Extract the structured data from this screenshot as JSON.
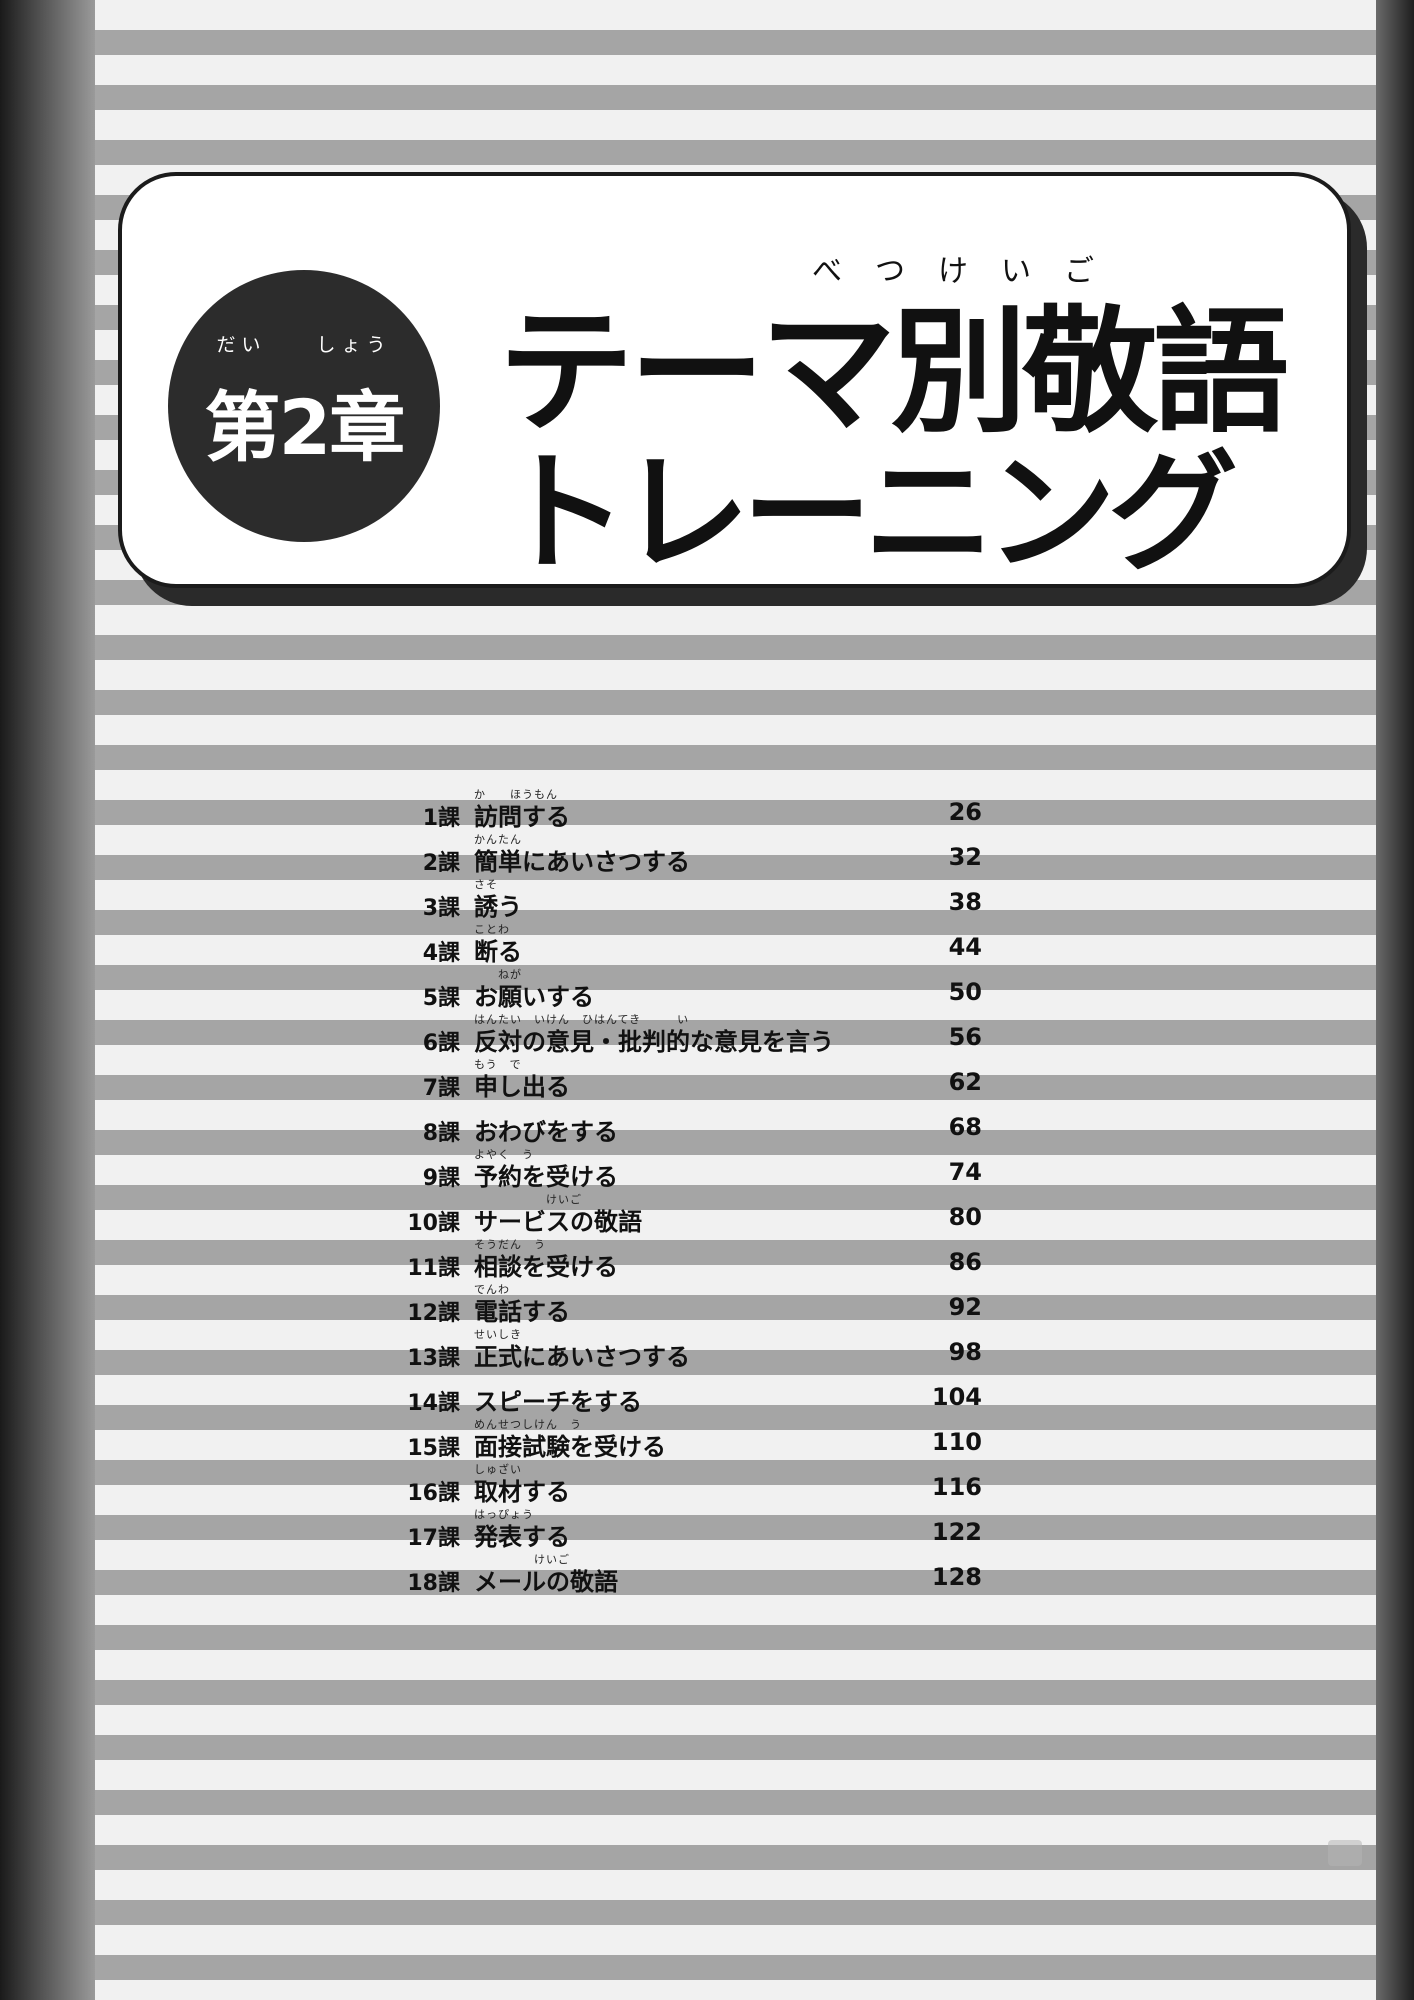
{
  "chapter": {
    "ruby": "だい　　しょう",
    "label": "第2章",
    "title_ruby": "べつけいご",
    "title_line1": "テーマ別敬語",
    "title_line2": "トレーニング"
  },
  "toc": [
    {
      "num": "1課",
      "ruby": "か　　ほうもん",
      "title": "訪問する",
      "page": "26"
    },
    {
      "num": "2課",
      "ruby": "かんたん",
      "title": "簡単にあいさつする",
      "page": "32"
    },
    {
      "num": "3課",
      "ruby": "さそ",
      "title": "誘う",
      "page": "38"
    },
    {
      "num": "4課",
      "ruby": "ことわ",
      "title": "断る",
      "page": "44"
    },
    {
      "num": "5課",
      "ruby": "　　ねが",
      "title": "お願いする",
      "page": "50"
    },
    {
      "num": "6課",
      "ruby": "はんたい　いけん　ひはんてき　　　い",
      "title": "反対の意見・批判的な意見を言う",
      "page": "56"
    },
    {
      "num": "7課",
      "ruby": "もう　で",
      "title": "申し出る",
      "page": "62"
    },
    {
      "num": "8課",
      "ruby": "",
      "title": "おわびをする",
      "page": "68"
    },
    {
      "num": "9課",
      "ruby": "よやく　う",
      "title": "予約を受ける",
      "page": "74"
    },
    {
      "num": "10課",
      "ruby": "　　　　　　けいご",
      "title": "サービスの敬語",
      "page": "80"
    },
    {
      "num": "11課",
      "ruby": "そうだん　う",
      "title": "相談を受ける",
      "page": "86"
    },
    {
      "num": "12課",
      "ruby": "でんわ",
      "title": "電話する",
      "page": "92"
    },
    {
      "num": "13課",
      "ruby": "せいしき",
      "title": "正式にあいさつする",
      "page": "98"
    },
    {
      "num": "14課",
      "ruby": "",
      "title": "スピーチをする",
      "page": "104"
    },
    {
      "num": "15課",
      "ruby": "めんせつしけん　う",
      "title": "面接試験を受ける",
      "page": "110"
    },
    {
      "num": "16課",
      "ruby": "しゅざい",
      "title": "取材する",
      "page": "116"
    },
    {
      "num": "17課",
      "ruby": "はっぴょう",
      "title": "発表する",
      "page": "122"
    },
    {
      "num": "18課",
      "ruby": "　　　　　けいご",
      "title": "メールの敬語",
      "page": "128"
    }
  ]
}
